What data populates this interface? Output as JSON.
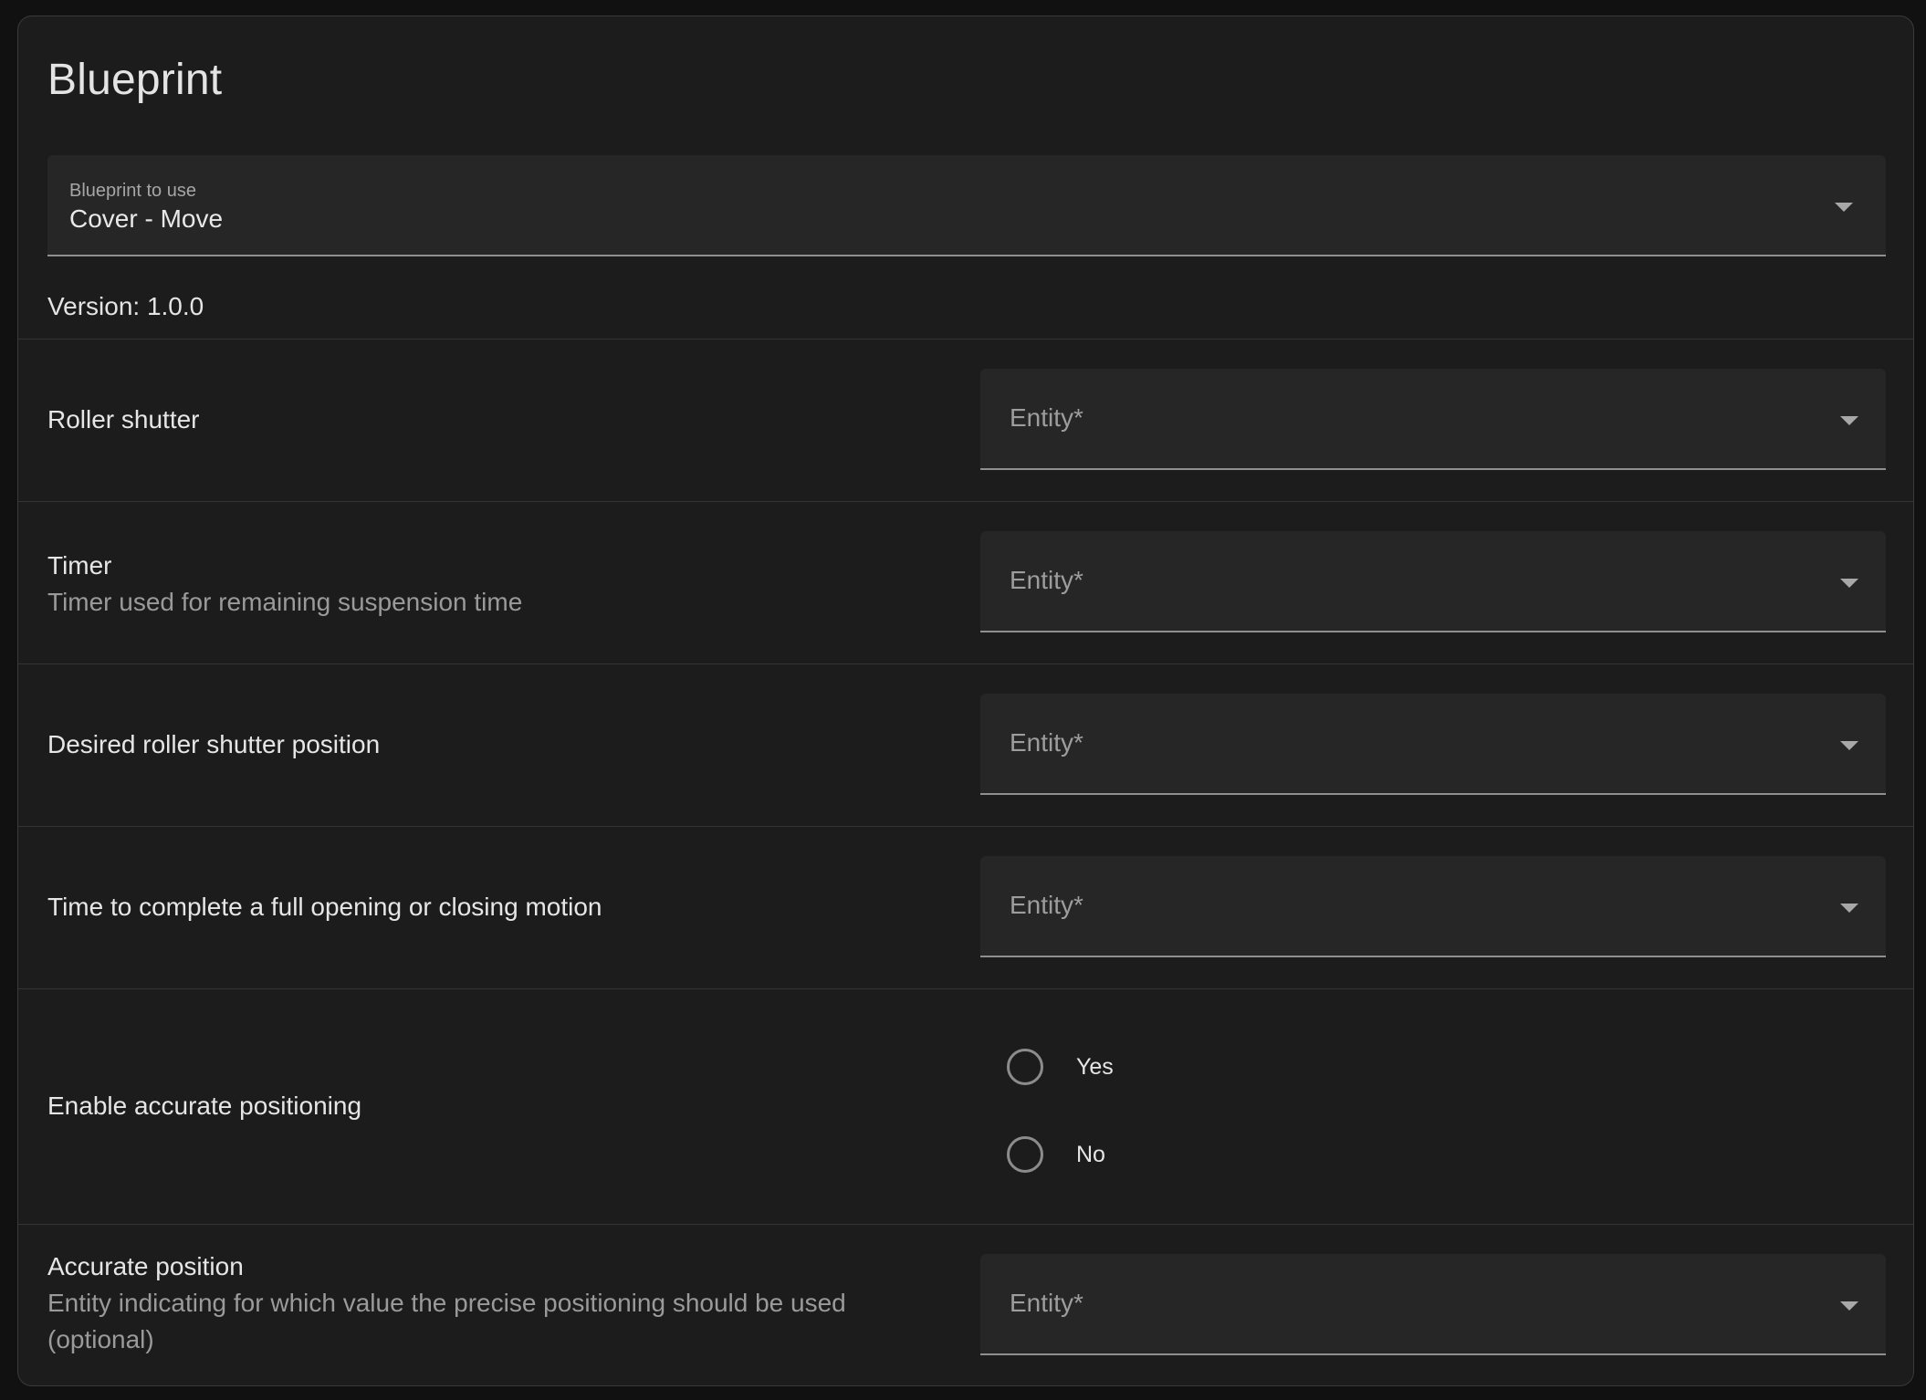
{
  "card": {
    "title": "Blueprint"
  },
  "blueprint_select": {
    "label": "Blueprint to use",
    "value": "Cover - Move"
  },
  "version": "Version: 1.0.0",
  "rows": [
    {
      "title": "Roller shutter",
      "description": "",
      "placeholder": "Entity*"
    },
    {
      "title": "Timer",
      "description": "Timer used for remaining suspension time",
      "placeholder": "Entity*"
    },
    {
      "title": "Desired roller shutter position",
      "description": "",
      "placeholder": "Entity*"
    },
    {
      "title": "Time to complete a full opening or closing motion",
      "description": "",
      "placeholder": "Entity*"
    },
    {
      "title": "Enable accurate positioning",
      "options": [
        "Yes",
        "No"
      ]
    },
    {
      "title": "Accurate position",
      "description": "Entity indicating for which value the precise positioning should be used (optional)",
      "placeholder": "Entity*"
    }
  ],
  "colors": {
    "background": "#1c1c1c",
    "field": "#262626",
    "divider": "#333333"
  }
}
